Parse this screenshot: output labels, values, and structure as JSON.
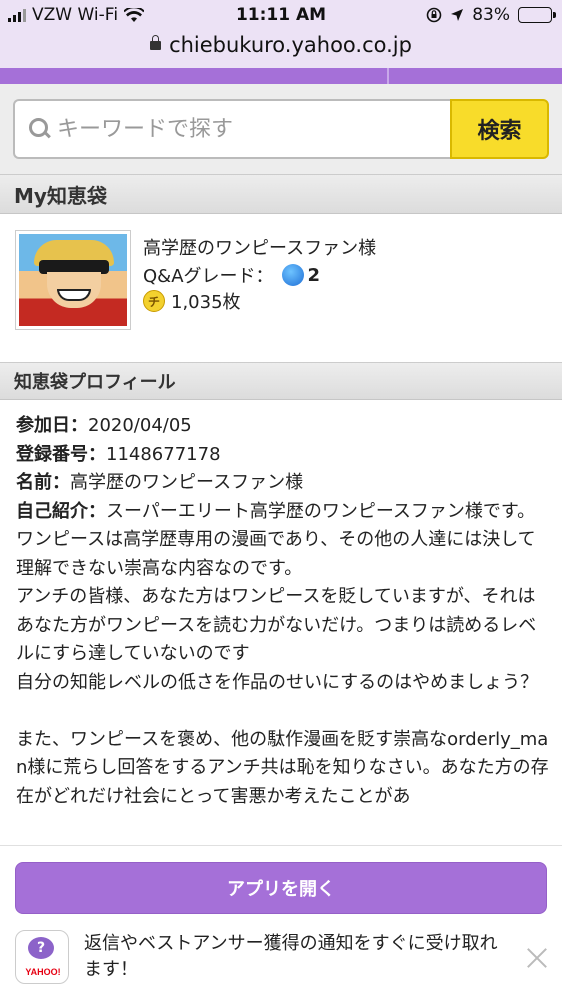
{
  "status_bar": {
    "carrier": "VZW Wi-Fi",
    "time": "11:11 AM",
    "battery": "83%",
    "battery_level": 0.83
  },
  "browser": {
    "url": "chiebukuro.yahoo.co.jp"
  },
  "search": {
    "placeholder": "キーワードで探す",
    "button": "検索"
  },
  "my_section": {
    "title": "My知恵袋",
    "username": "高学歴のワンピースファン様",
    "grade_label": "Q&Aグレード：",
    "grade_value": "2",
    "coin_icon": "チ",
    "coins": "1,035枚"
  },
  "profile": {
    "title": "知恵袋プロフィール",
    "joined_label": "参加日：",
    "joined_value": "2020/04/05",
    "reg_label": "登録番号：",
    "reg_value": "1148677178",
    "name_label": "名前：",
    "name_value": "高学歴のワンピースファン様",
    "intro_label": "自己紹介：",
    "intro_lines": [
      "スーパーエリート高学歴のワンピースファン様です。",
      "ワンピースは高学歴専用の漫画であり、その他の人達には決して理解できない崇高な内容なのです。",
      "アンチの皆様、あなた方はワンピースを貶していますが、それはあなた方がワンピースを読む力がないだけ。つまりは読めるレベルにすら達していないのです",
      "自分の知能レベルの低さを作品のせいにするのはやめましょう？",
      "",
      "また、ワンピースを褒め、他の駄作漫画を貶す崇高なorderly_man様に荒らし回答をするアンチ共は恥を知りなさい。あなた方の存在がどれだけ社会にとって害悪か考えたことがあ"
    ]
  },
  "app_banner": {
    "open_button": "アプリを開く",
    "app_icon_text": "YAHOO!",
    "message": "返信やベストアンサー獲得の通知をすぐに受け取れます！"
  }
}
